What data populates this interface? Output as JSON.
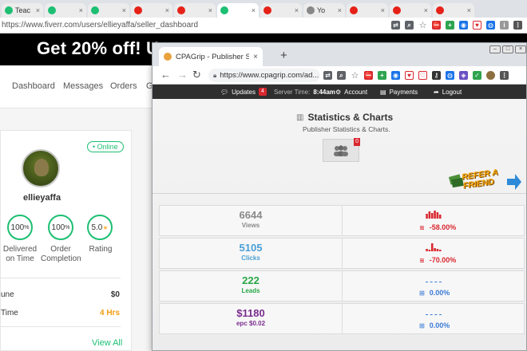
{
  "background_browser": {
    "tabs": [
      {
        "label": "Teac",
        "fav_color": "#1dbf73",
        "active": false
      },
      {
        "label": "",
        "fav_color": "#1dbf73",
        "active": false
      },
      {
        "label": "",
        "fav_color": "#1dbf73",
        "active": false
      },
      {
        "label": "",
        "fav_color": "#e62117",
        "active": false
      },
      {
        "label": "",
        "fav_color": "#e62117",
        "active": false
      },
      {
        "label": "",
        "fav_color": "#1dbf73",
        "active": true
      },
      {
        "label": "",
        "fav_color": "#e62117",
        "active": false
      },
      {
        "label": "Yo",
        "fav_color": "#888888",
        "active": false
      },
      {
        "label": "",
        "fav_color": "#e62117",
        "active": false
      },
      {
        "label": "",
        "fav_color": "#e62117",
        "active": false
      },
      {
        "label": "",
        "fav_color": "#e62117",
        "active": false
      }
    ],
    "url": "https://www.fiverr.com/users/ellieyaffa/seller_dashboard"
  },
  "fiverr": {
    "promo": "Get 20% off! U",
    "nav": [
      "Dashboard",
      "Messages",
      "Orders",
      "G"
    ],
    "online_label": "• Online",
    "username": "ellieyaffa",
    "stats": [
      {
        "value": "100",
        "unit": "%",
        "label": "Delivered on Time"
      },
      {
        "value": "100",
        "unit": "%",
        "label": "Order Completion"
      },
      {
        "value": "5.0",
        "unit": "★",
        "label": "Rating"
      }
    ],
    "earned_label": "une",
    "earned_value": "$0",
    "response_label": "Time",
    "response_value": "4 Hrs",
    "view_all": "View All",
    "accent": "#1dbf73"
  },
  "cpagrip_browser": {
    "tab_title": "CPAGrip - Publisher Stats",
    "tab_close": "×",
    "new_tab": "+",
    "url": "https://www.cpagrip.com/ad..."
  },
  "cpagrip": {
    "topbar": {
      "updates": "Updates",
      "updates_badge": "4",
      "server_time_label": "Server Time:",
      "server_time": "8:44am",
      "account": "Account",
      "payments": "Payments",
      "logout": "Logout"
    },
    "title": "Statistics & Charts",
    "subtitle": "Publisher Statistics & Charts.",
    "users_badge": "0",
    "refer_line1": "REFER A",
    "refer_line2": "FRIEND",
    "rows": [
      {
        "value": "6644",
        "name": "Views",
        "color": "#8a8a8a",
        "change": "-58.00%",
        "change_color": "#d9272e",
        "trend": "down",
        "spark": [
          0.6,
          0.9,
          0.7,
          1.0,
          0.8,
          0.5
        ]
      },
      {
        "value": "5105",
        "name": "Clicks",
        "color": "#4a9fd6",
        "change": "-70.00%",
        "change_color": "#d9272e",
        "trend": "down",
        "spark": [
          0.3,
          0.2,
          1.0,
          0.4,
          0.3,
          0.2
        ]
      },
      {
        "value": "222",
        "name": "Leads",
        "color": "#28a745",
        "change": "0.00%",
        "change_color": "#3a7bd5",
        "trend": "flat",
        "spark": []
      },
      {
        "value": "$1180",
        "name": "epc $0.02",
        "color": "#7b2d8e",
        "change": "0.00%",
        "change_color": "#3a7bd5",
        "trend": "flat",
        "spark": []
      }
    ]
  }
}
